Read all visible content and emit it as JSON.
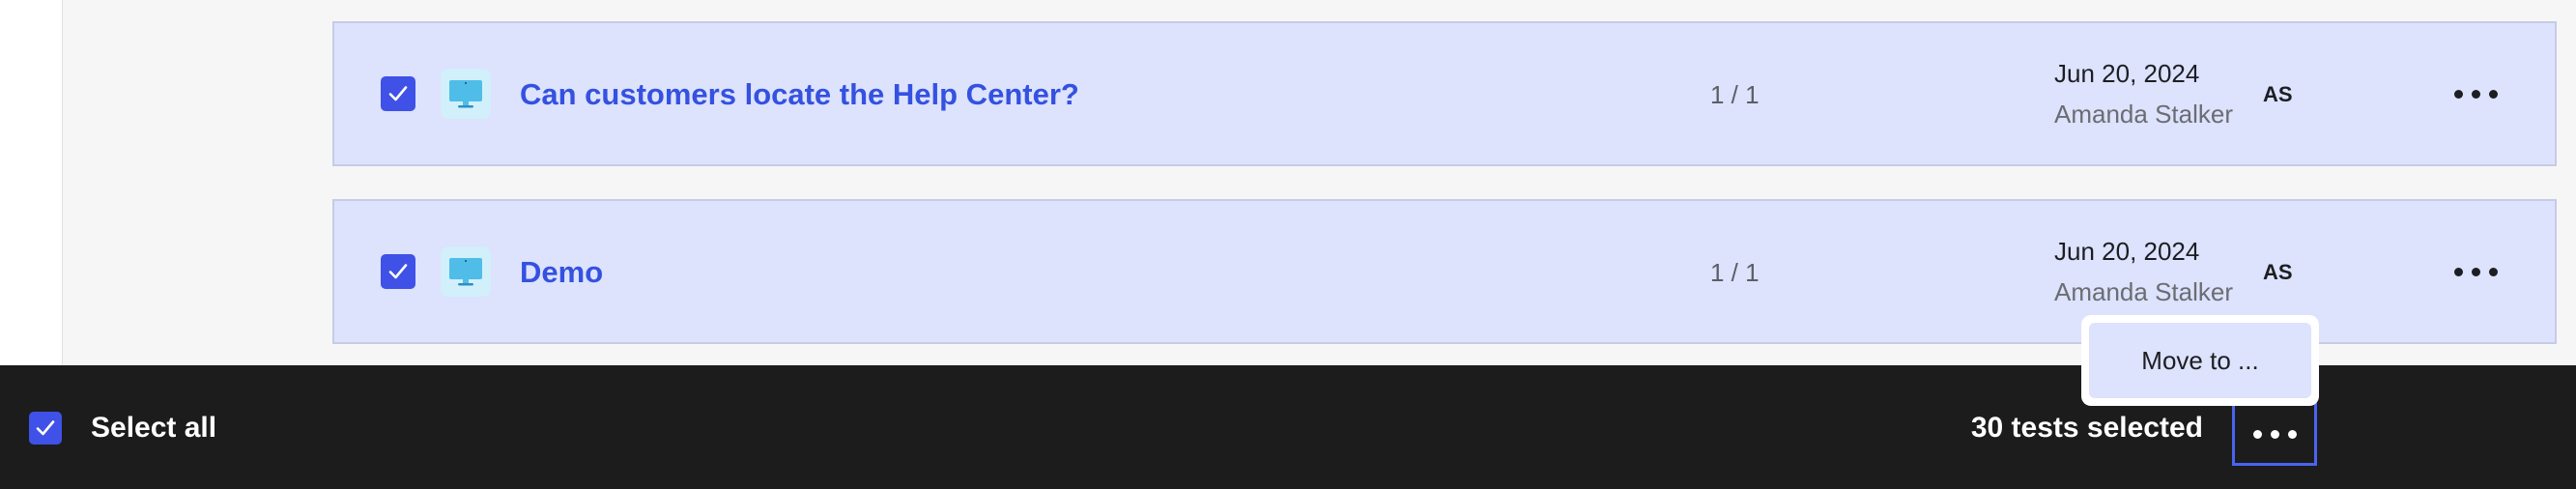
{
  "tests": [
    {
      "title": "Can customers locate the Help Center?",
      "count": "1 / 1",
      "date": "Jun 20, 2024",
      "author": "Amanda Stalker",
      "initials": "AS",
      "checked": true,
      "type_icon": "desktop-monitor-icon"
    },
    {
      "title": "Demo",
      "count": "1 / 1",
      "date": "Jun 20, 2024",
      "author": "Amanda Stalker",
      "initials": "AS",
      "checked": true,
      "type_icon": "desktop-monitor-icon"
    }
  ],
  "bulk_bar": {
    "select_all_label": "Select all",
    "selected_count_label": "30 tests selected",
    "more_icon": "more-horizontal-icon"
  },
  "bulk_menu": {
    "items": [
      {
        "label": "Move to ..."
      }
    ]
  },
  "colors": {
    "accent": "#3f51e6",
    "title_link": "#3451e0",
    "row_selected_bg": "#dde2fd",
    "bar_bg": "#1c1c1c",
    "monitor_icon": "#4fbde8"
  }
}
